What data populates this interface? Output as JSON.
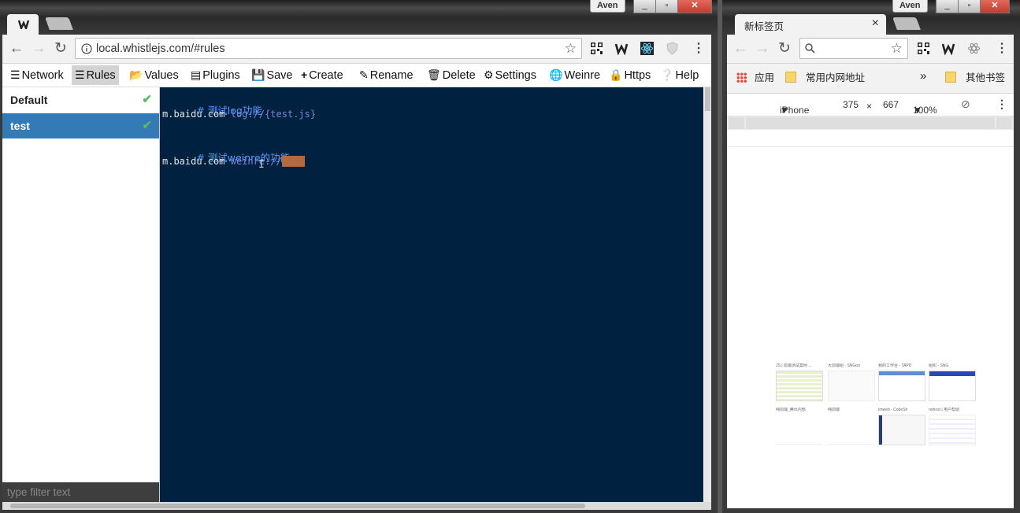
{
  "left_window": {
    "user": "Aven",
    "window_controls": [
      "_",
      "▫",
      "✕"
    ],
    "address": "local.whistlejs.com/#rules",
    "extensions": [
      "qr-code-icon",
      "whistle-icon",
      "react-icon",
      "shield-icon"
    ]
  },
  "right_window": {
    "user": "Aven",
    "window_controls": [
      "_",
      "▫",
      "✕"
    ],
    "tab_title": "新标签页",
    "tab_close": "×",
    "bookmarks": {
      "apps_label": "应用",
      "folder1": "常用内网地址",
      "more": "»",
      "folder2": "其他书签"
    },
    "device": {
      "name": "iPhone 6",
      "width": "375",
      "times": "×",
      "height": "667",
      "zoom": "100%"
    },
    "thumbnails": [
      {
        "title": "JS | 前端测试案例 ..."
      },
      {
        "title": "大前端组 · SNGori"
      },
      {
        "title": "我的工作台 - TAPD"
      },
      {
        "title": "组织 - SNG"
      },
      {
        "title": "纯前端_腾讯内部"
      },
      {
        "title": "纯前端"
      },
      {
        "title": "Imweb - CodeSh"
      },
      {
        "title": "nohost | 用户帮助"
      }
    ]
  },
  "whistle": {
    "menu": [
      {
        "label": "Network",
        "icon": "list-icon"
      },
      {
        "label": "Rules",
        "icon": "list-icon"
      },
      {
        "label": "Values",
        "icon": "folder-open-icon"
      },
      {
        "label": "Plugins",
        "icon": "plugin-icon"
      },
      {
        "label": "Save",
        "icon": "save-icon"
      },
      {
        "label": "Create",
        "icon": "plus-icon"
      },
      {
        "label": "Rename",
        "icon": "edit-icon"
      },
      {
        "label": "Delete",
        "icon": "trash-icon"
      },
      {
        "label": "Settings",
        "icon": "gear-icon"
      },
      {
        "label": "Weinre",
        "icon": "globe-icon"
      },
      {
        "label": "Https",
        "icon": "lock-icon"
      },
      {
        "label": "Help",
        "icon": "help-icon"
      }
    ],
    "active_menu": "Rules",
    "rule_groups": [
      {
        "name": "Default",
        "selected": false,
        "enabled": true
      },
      {
        "name": "test",
        "selected": true,
        "enabled": true
      }
    ],
    "filter_placeholder": "type filter text",
    "editor": {
      "line1_comment": "# 测试log功能",
      "line2_host": "m.baidu.com",
      "line2_value": "log://{test.js}",
      "line4_comment": "# 测试weinre的功能",
      "line5_host": "m.baidu.com",
      "line5_value": "weinre://",
      "line5_selected": "test"
    },
    "colors": {
      "editor_bg": "#002240",
      "selected_rule": "#337ab7",
      "check": "#5cb85c",
      "comment": "#5b9bff"
    }
  }
}
